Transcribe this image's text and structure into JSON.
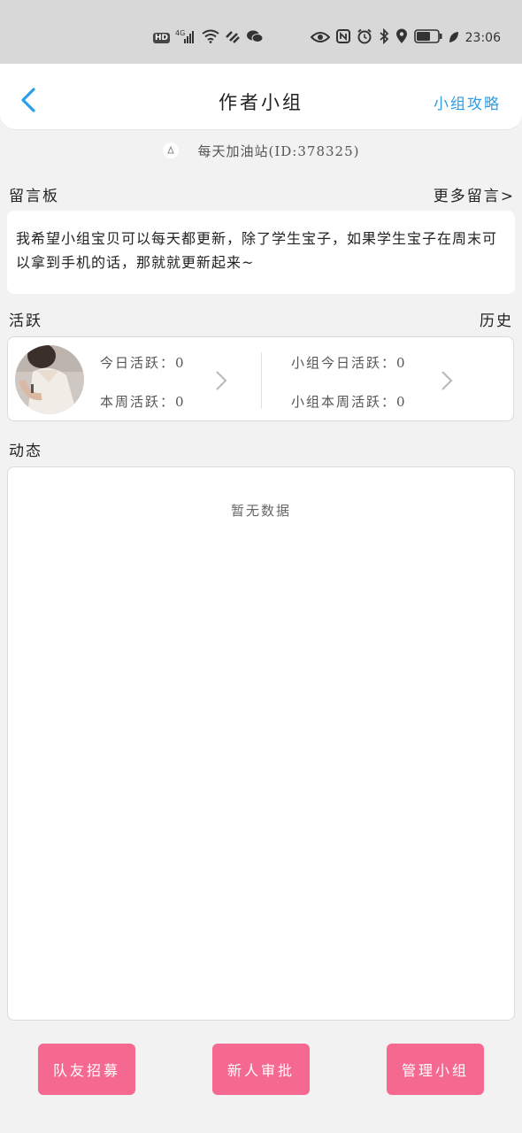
{
  "status_bar": {
    "time": "23:06",
    "battery": "62",
    "network": "4G",
    "hd": "HD"
  },
  "header": {
    "title": "作者小组",
    "action": "小组攻略"
  },
  "group": {
    "name_id": "每天加油站(ID:378325)"
  },
  "message_board": {
    "title": "留言板",
    "more": "更多留言>",
    "content": "我希望小组宝贝可以每天都更新，除了学生宝子，如果学生宝子在周末可以拿到手机的话，那就就更新起来~"
  },
  "activity": {
    "title": "活跃",
    "history": "历史",
    "today": "今日活跃：0",
    "week": "本周活跃：0",
    "group_today": "小组今日活跃：0",
    "group_week": "小组本周活跃：0"
  },
  "feed": {
    "title": "动态",
    "empty": "暂无数据"
  },
  "buttons": {
    "recruit": "队友招募",
    "review": "新人审批",
    "manage": "管理小组"
  },
  "colors": {
    "accent": "#2a9ee8",
    "button": "#f56990",
    "status_bar": "#d8d8d8"
  }
}
